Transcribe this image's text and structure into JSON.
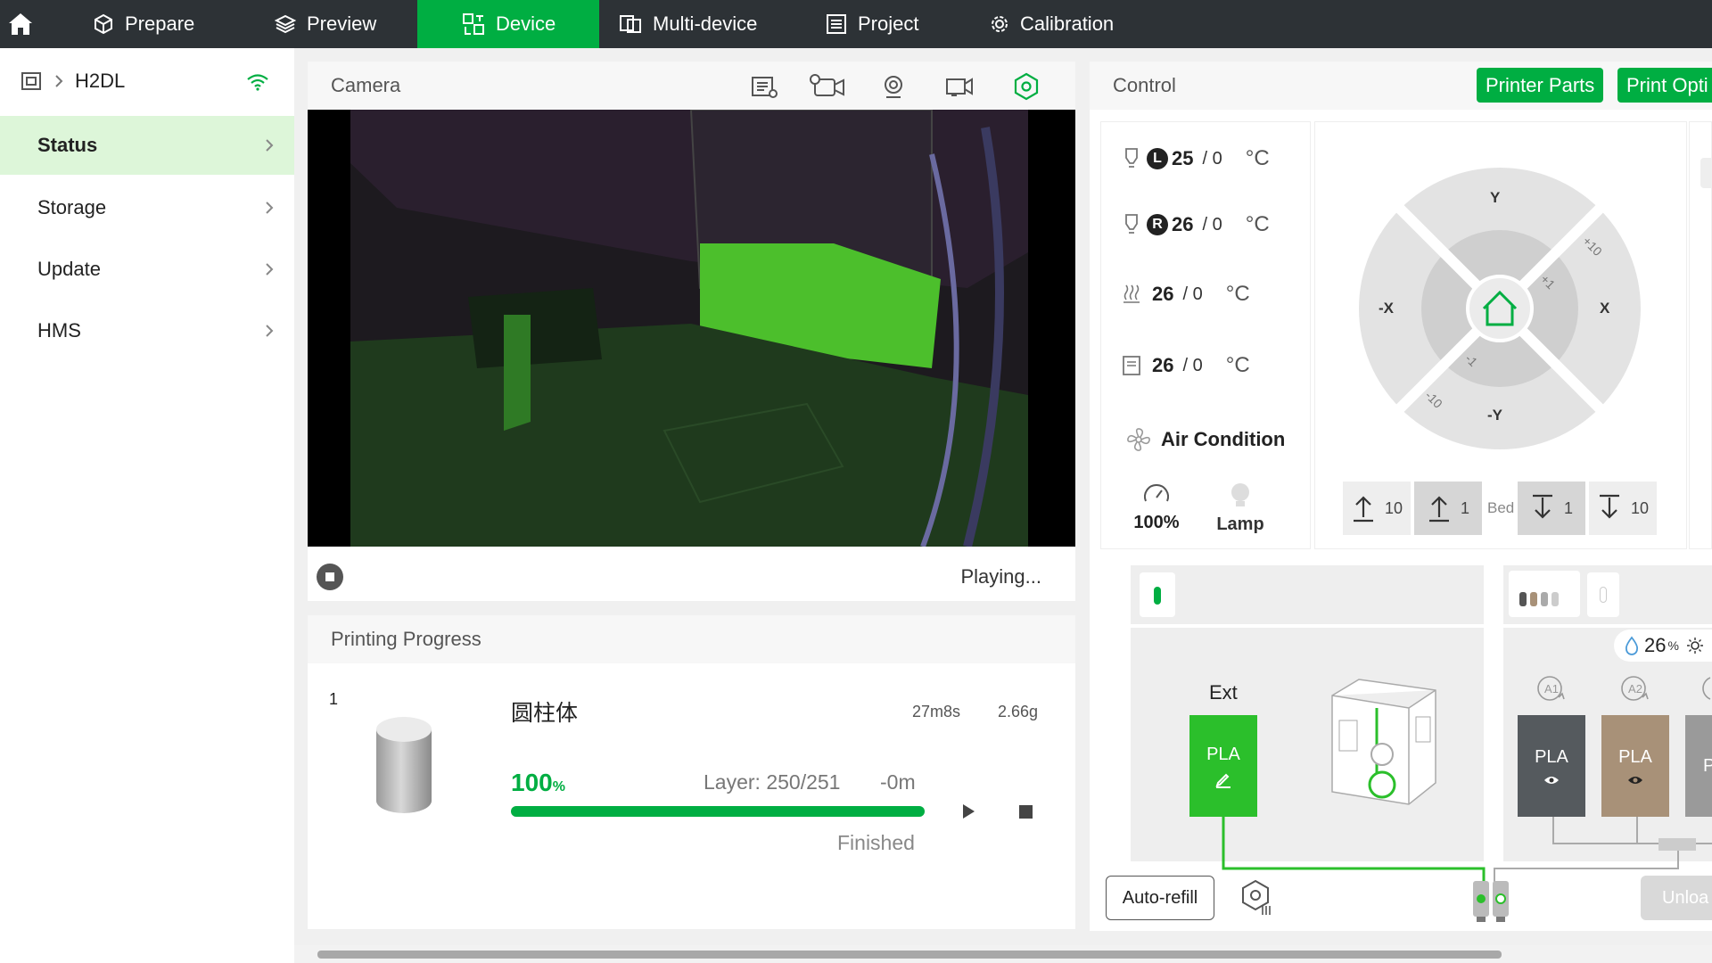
{
  "nav": {
    "tabs": [
      {
        "label": "Prepare"
      },
      {
        "label": "Preview"
      },
      {
        "label": "Device"
      },
      {
        "label": "Multi-device"
      },
      {
        "label": "Project"
      },
      {
        "label": "Calibration"
      }
    ],
    "active_tab": "Device"
  },
  "sidebar": {
    "printer_name": "H2DL",
    "items": [
      {
        "label": "Status"
      },
      {
        "label": "Storage"
      },
      {
        "label": "Update"
      },
      {
        "label": "HMS"
      }
    ]
  },
  "camera": {
    "title": "Camera",
    "status_text": "Playing..."
  },
  "progress": {
    "title": "Printing Progress",
    "plate_index": "1",
    "job_name": "圆柱体",
    "time": "27m8s",
    "weight": "2.66g",
    "percent_value": "100",
    "percent_unit": "%",
    "percent_fraction": 1.0,
    "layer_text": "Layer: 250/251",
    "remaining": "-0m",
    "state": "Finished"
  },
  "control": {
    "title": "Control",
    "printer_parts_label": "Printer Parts",
    "print_options_label": "Print Opti",
    "temps": [
      {
        "badge": "L",
        "current": "25",
        "target": "/ 0",
        "unit": "°C"
      },
      {
        "badge": "R",
        "current": "26",
        "target": "/ 0",
        "unit": "°C"
      },
      {
        "badge": "",
        "current": "26",
        "target": "/ 0",
        "unit": "°C"
      },
      {
        "badge": "",
        "current": "26",
        "target": "/ 0",
        "unit": "°C"
      }
    ],
    "air_condition_label": "Air Condition",
    "speed_value": "100%",
    "lamp_label": "Lamp",
    "jog": {
      "y_label": "Y",
      "neg_y_label": "-Y",
      "x_label": "X",
      "neg_x_label": "-X",
      "plus10": "+10",
      "plus1": "+1",
      "minus1": "-1",
      "minus10": "-10"
    },
    "bed": {
      "up10": "10",
      "up1": "1",
      "label": "Bed",
      "down1": "1",
      "down10": "10"
    }
  },
  "ams": {
    "humidity_value": "26",
    "humidity_unit": "%",
    "ext_label": "Ext",
    "ext_spool_label": "PLA",
    "slot_labels": [
      "A1",
      "A2"
    ],
    "spools": [
      {
        "label": "PLA",
        "color": "#555a5e"
      },
      {
        "label": "PLA",
        "color": "#a89178"
      },
      {
        "label": "P",
        "color": "#9a9a9a"
      }
    ],
    "ext_color": "#2bbf2b",
    "auto_refill_label": "Auto-refill",
    "unload_label": "Unloa"
  },
  "colors": {
    "accent": "#00ae42",
    "nav_bg": "#2d3236",
    "sidebar_active": "#ddf6d9"
  }
}
